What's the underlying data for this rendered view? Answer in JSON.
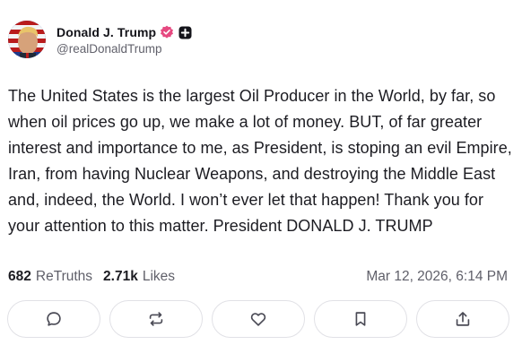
{
  "author": {
    "display_name": "Donald J. Trump",
    "handle": "@realDonaldTrump",
    "verified_icon": "verified-badge-icon",
    "plus_icon": "plus-badge-icon",
    "avatar_icon": "avatar"
  },
  "post": {
    "text": "The United States is the largest Oil Producer in the World, by far, so when oil prices go up, we make a lot of money. BUT, of far greater interest and importance to me, as President, is stoping an evil Empire, Iran, from having Nuclear Weapons, and destroying the Middle East and, indeed, the World. I won’t ever let that happen! Thank you for your attention to this matter. President DONALD J. TRUMP"
  },
  "stats": {
    "retruths_count": "682",
    "retruths_label": "ReTruths",
    "likes_count": "2.71k",
    "likes_label": "Likes"
  },
  "timestamp": "Mar 12, 2026, 6:14 PM",
  "actions": {
    "icons": [
      "reply-icon",
      "retruth-icon",
      "like-icon",
      "bookmark-icon",
      "share-icon"
    ]
  },
  "colors": {
    "verified": "#e64980",
    "text": "#1c1c22",
    "muted": "#5f5f69",
    "border": "#e1e1e6",
    "icon": "#4a4a55"
  }
}
